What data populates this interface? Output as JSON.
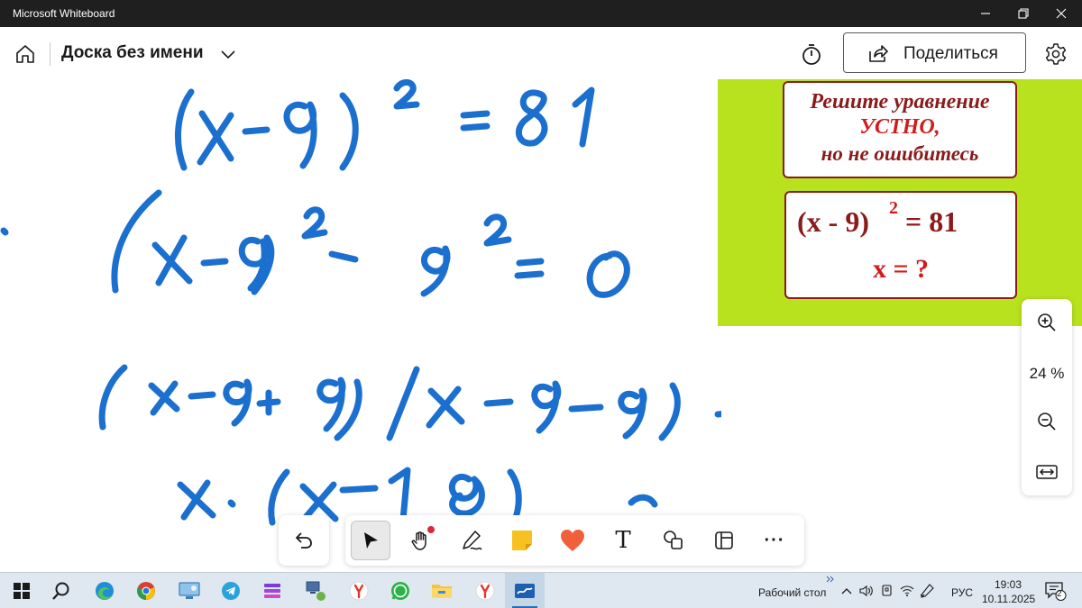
{
  "window": {
    "title": "Microsoft Whiteboard"
  },
  "header": {
    "board_title": "Доска без имени",
    "share_label": "Поделиться"
  },
  "card": {
    "line1": "Решите уравнение",
    "line2": "УСТНО,",
    "line3": "но не ошибитесь",
    "equation_left": "(x -  9)",
    "equation_exponent": "2",
    "equation_right": "=  81",
    "question": "x = ?",
    "background_color": "#b8e21e",
    "text_color": "#8b1a1a",
    "accent_color": "#d31a1a"
  },
  "ink": {
    "color": "#1b6fce",
    "content": "Handwritten solution: (x-9)^2 = 81; (x-9)^2 - 9^2 = 0; (x-9+9)(x-9-9) = 0; x·(x-18) = 0"
  },
  "zoom": {
    "level": "24 %"
  },
  "toolbar": {
    "tools": [
      "undo-icon",
      "select-icon",
      "pan-icon",
      "pen-icon",
      "sticky-note-icon",
      "reaction-icon",
      "text-icon",
      "shapes-icon",
      "templates-icon",
      "more-icon"
    ],
    "text_tool_glyph": "T",
    "more_glyph": "···",
    "active_tool": "select-icon"
  },
  "taskbar": {
    "desktop_label": "Рабочий стол",
    "language": "РУС",
    "time": "19:03",
    "date": "10.11.2025",
    "notification_count": "2"
  }
}
